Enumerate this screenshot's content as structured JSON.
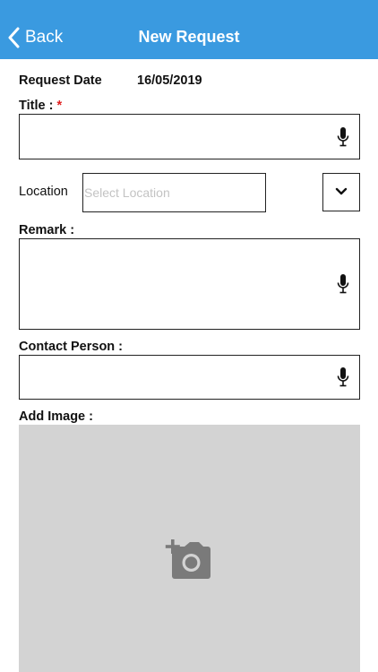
{
  "navbar": {
    "back_label": "Back",
    "title": "New Request",
    "color": "#3a9ae0"
  },
  "form": {
    "request_date_label": "Request Date",
    "request_date_value": "16/05/2019",
    "title_label": "Title :",
    "required_marker": "*",
    "title_value": "",
    "location_label": "Location",
    "location_placeholder": "Select Location",
    "remark_label": "Remark :",
    "remark_value": "",
    "contact_person_label": "Contact Person :",
    "contact_person_value": "",
    "add_image_label": "Add Image :"
  },
  "icons": {
    "back": "chevron-left-icon",
    "mic": "microphone-icon",
    "dropdown": "chevron-down-icon",
    "add_photo": "add-photo-camera-icon"
  },
  "colors": {
    "required": "#e02020",
    "image_placeholder_bg": "#d3d3d3",
    "camera_icon": "#7a7a7a"
  }
}
